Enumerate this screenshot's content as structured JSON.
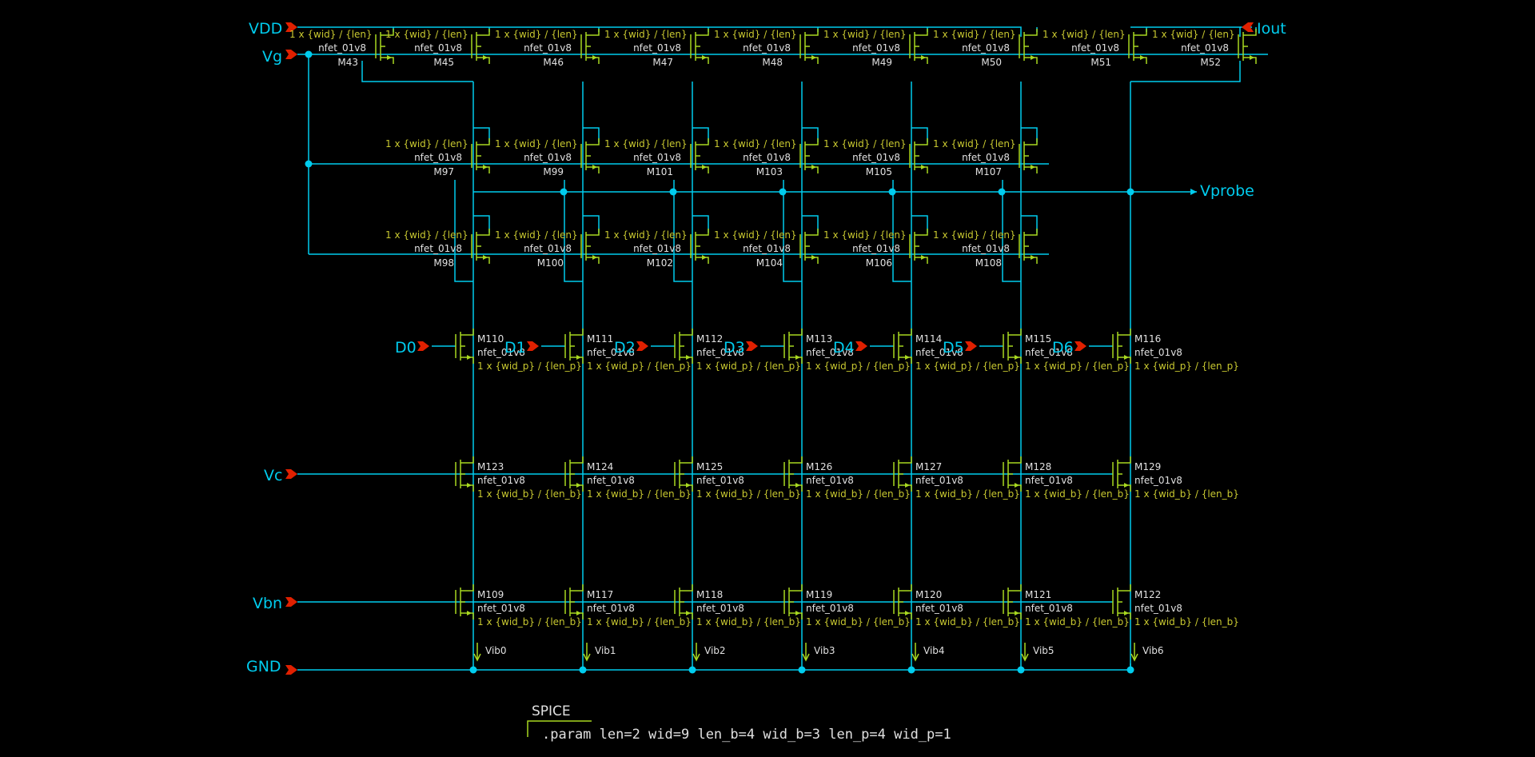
{
  "colors": {
    "background": "#000000",
    "wire": "#00ccee",
    "device": "#a8d820",
    "param_text": "#c8c830",
    "label_text": "#e0e0e0",
    "port_text": "#00ccee",
    "pin": "#e02000"
  },
  "ports": {
    "vdd": "VDD",
    "vg": "Vg",
    "iout": "Iout",
    "vprobe": "Vprobe",
    "vc": "Vc",
    "vbn": "Vbn",
    "gnd": "GND",
    "d": [
      "D0",
      "D1",
      "D2",
      "D3",
      "D4",
      "D5",
      "D6"
    ]
  },
  "mirror_row": {
    "names": [
      "M43",
      "M45",
      "M46",
      "M47",
      "M48",
      "M49",
      "M50",
      "M51",
      "M52"
    ],
    "model": "nfet_01v8",
    "param": "1 x {wid} / {len}"
  },
  "cascode_row_1": {
    "names": [
      "M97",
      "M99",
      "M101",
      "M103",
      "M105",
      "M107"
    ],
    "model": "nfet_01v8",
    "param": "1 x {wid} / {len}"
  },
  "cascode_row_2": {
    "names": [
      "M98",
      "M100",
      "M102",
      "M104",
      "M106",
      "M108"
    ],
    "model": "nfet_01v8",
    "param": "1 x {wid} / {len}"
  },
  "switch_row": {
    "names": [
      "M110",
      "M111",
      "M112",
      "M113",
      "M114",
      "M115",
      "M116"
    ],
    "model": "nfet_01v8",
    "param": "1 x {wid_p} / {len_p}"
  },
  "vc_row": {
    "names": [
      "M123",
      "M124",
      "M125",
      "M126",
      "M127",
      "M128",
      "M129"
    ],
    "model": "nfet_01v8",
    "param": "1 x {wid_b} / {len_b}"
  },
  "bias_row": {
    "names": [
      "M109",
      "M117",
      "M118",
      "M119",
      "M120",
      "M121",
      "M122"
    ],
    "model": "nfet_01v8",
    "param": "1 x {wid_b} / {len_b}"
  },
  "current_sources": [
    "Vib0",
    "Vib1",
    "Vib2",
    "Vib3",
    "Vib4",
    "Vib5",
    "Vib6"
  ],
  "spice": {
    "title": "SPICE",
    "code": ".param len=2 wid=9 len_b=4 wid_b=3 len_p=4 wid_p=1"
  }
}
